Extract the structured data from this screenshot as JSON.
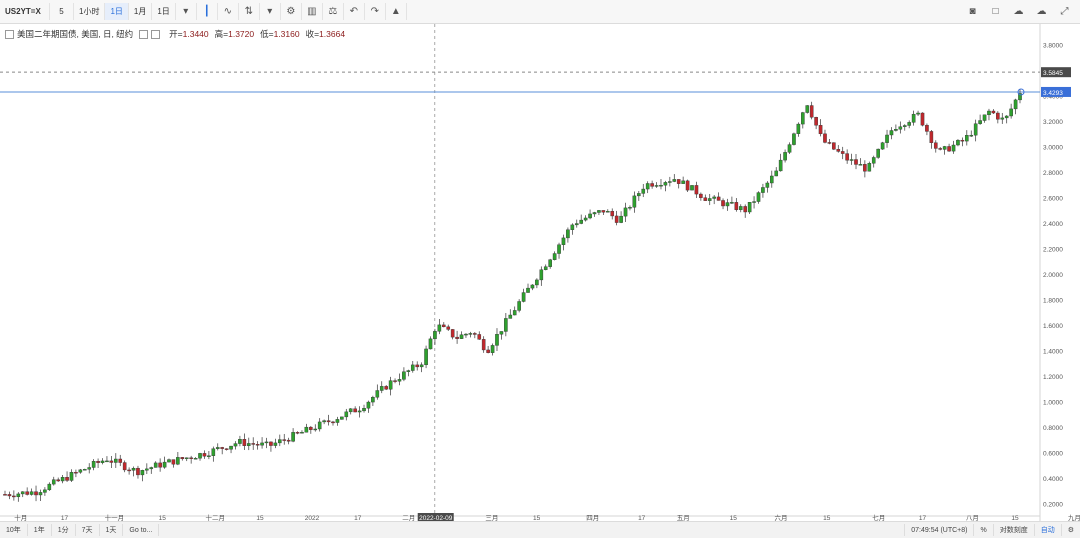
{
  "toolbar": {
    "symbol": "US2YT=X",
    "interval": "5",
    "timeframes": [
      "1小时",
      "1日",
      "1月",
      "1日"
    ],
    "selected_index": 1
  },
  "legend": {
    "title": "美国二年期国债, 美国, 日, 纽约",
    "open_label": "开=",
    "open": "1.3440",
    "high_label": "高=",
    "high": "1.3720",
    "low_label": "低=",
    "low": "1.3160",
    "close_label": "收=",
    "close": "1.3664"
  },
  "colors": {
    "up": "#2ea02e",
    "down": "#c0282d",
    "crosshair": "#5a8fd8"
  },
  "bottom": {
    "ranges": [
      "10年",
      "1年",
      "1分",
      "7天",
      "1天",
      "Go to..."
    ],
    "time": "07:49:54 (UTC+8)",
    "percent": "%",
    "log": "对数刻度",
    "auto": "自动"
  },
  "chart_data": {
    "type": "candlestick",
    "ylim": [
      0.1,
      3.9
    ],
    "y_ticks": [
      "3.8000",
      "3.6000",
      "3.4000",
      "3.2000",
      "3.0000",
      "2.8000",
      "2.6000",
      "2.4000",
      "2.2000",
      "2.0000",
      "1.8000",
      "1.6000",
      "1.4000",
      "1.2000",
      "1.0000",
      "0.8000",
      "0.6000",
      "0.4000",
      "0.2000"
    ],
    "x_ticks": [
      "十月",
      "17",
      "十一月",
      "15",
      "十二月",
      "15",
      "2022",
      "17",
      "二月",
      "三月",
      "15",
      "四月",
      "17",
      "五月",
      "15",
      "六月",
      "15",
      "七月",
      "17",
      "八月",
      "15",
      "九月"
    ],
    "x_tick_positions": [
      0.02,
      0.062,
      0.11,
      0.156,
      0.207,
      0.25,
      0.3,
      0.344,
      0.393,
      0.473,
      0.516,
      0.57,
      0.617,
      0.657,
      0.705,
      0.751,
      0.795,
      0.845,
      0.887,
      0.935,
      0.976,
      1.033
    ],
    "crosshair_date": "2022-02-09",
    "crosshair_x": 0.418,
    "current_price": "3.4293",
    "dashed_price": "3.5845",
    "crosshair_price": 3.4293,
    "dashed_level": 3.5845,
    "anchors": [
      [
        0.0,
        0.27
      ],
      [
        0.03,
        0.29
      ],
      [
        0.06,
        0.4
      ],
      [
        0.1,
        0.55
      ],
      [
        0.13,
        0.45
      ],
      [
        0.16,
        0.52
      ],
      [
        0.2,
        0.6
      ],
      [
        0.23,
        0.68
      ],
      [
        0.26,
        0.65
      ],
      [
        0.3,
        0.78
      ],
      [
        0.35,
        0.95
      ],
      [
        0.38,
        1.15
      ],
      [
        0.41,
        1.3
      ],
      [
        0.425,
        1.6
      ],
      [
        0.445,
        1.5
      ],
      [
        0.46,
        1.55
      ],
      [
        0.475,
        1.4
      ],
      [
        0.5,
        1.7
      ],
      [
        0.53,
        2.05
      ],
      [
        0.56,
        2.4
      ],
      [
        0.59,
        2.5
      ],
      [
        0.605,
        2.42
      ],
      [
        0.63,
        2.7
      ],
      [
        0.66,
        2.75
      ],
      [
        0.69,
        2.6
      ],
      [
        0.73,
        2.5
      ],
      [
        0.76,
        2.8
      ],
      [
        0.79,
        3.35
      ],
      [
        0.805,
        3.05
      ],
      [
        0.83,
        2.9
      ],
      [
        0.85,
        2.82
      ],
      [
        0.875,
        3.15
      ],
      [
        0.9,
        3.25
      ],
      [
        0.92,
        2.95
      ],
      [
        0.945,
        3.05
      ],
      [
        0.97,
        3.28
      ],
      [
        0.985,
        3.2
      ],
      [
        1.0,
        3.43
      ]
    ]
  }
}
